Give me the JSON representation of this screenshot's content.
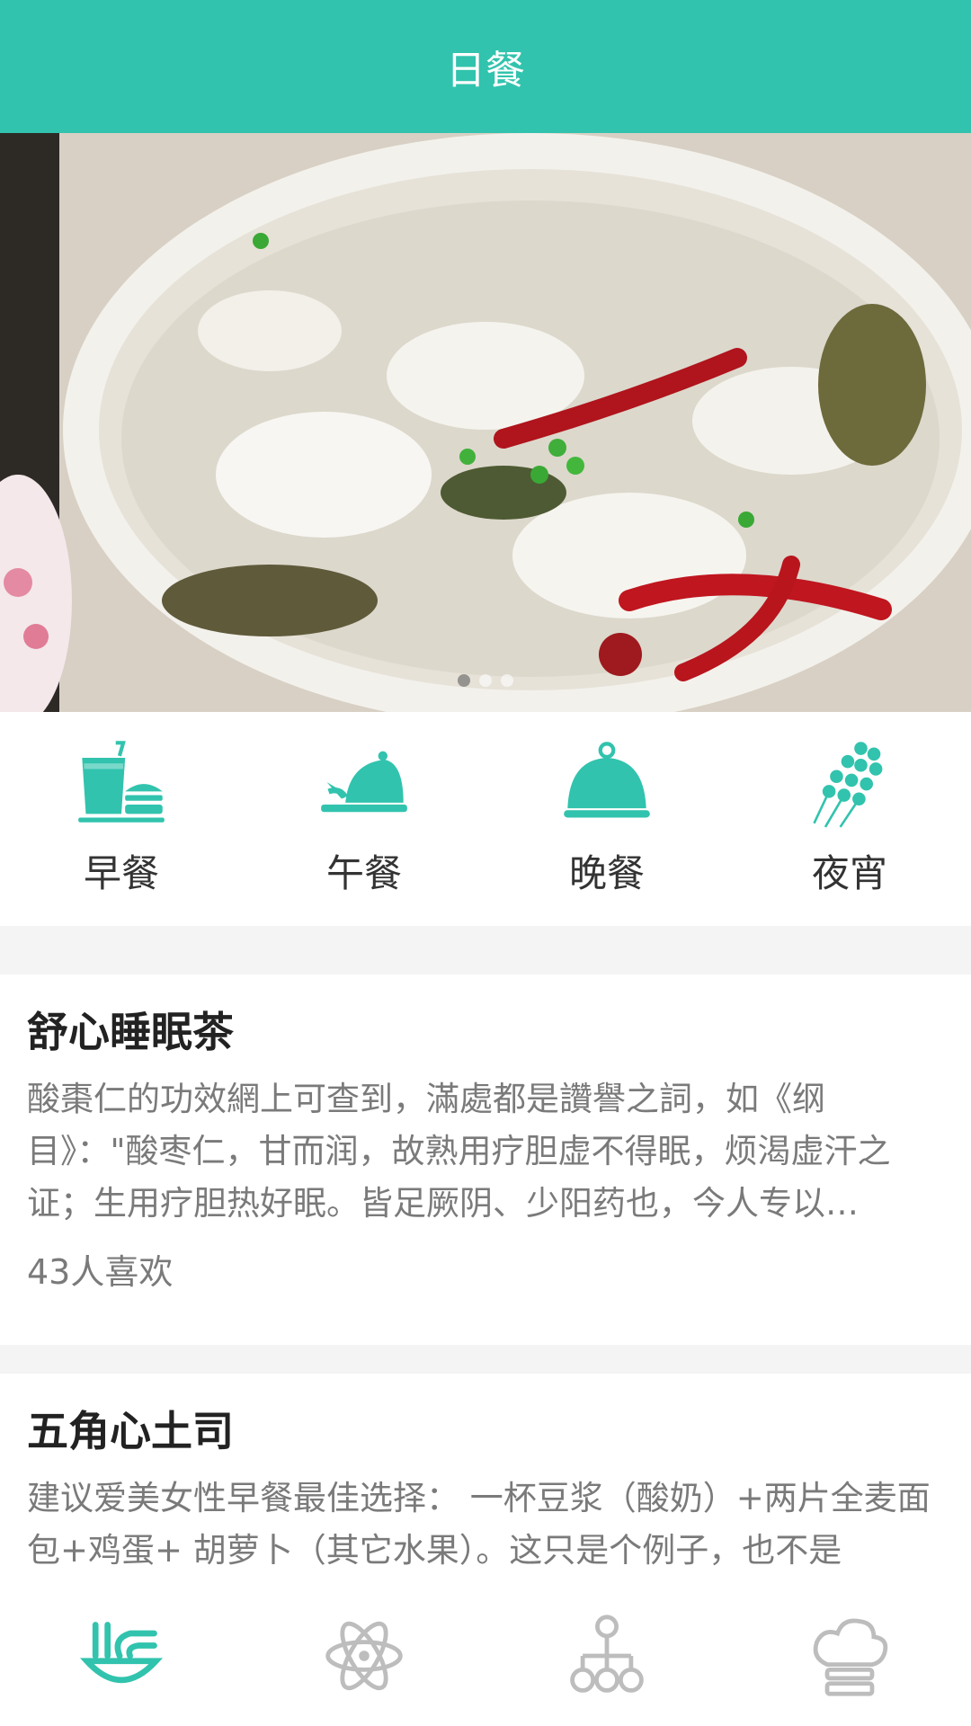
{
  "header": {
    "title": "日餐"
  },
  "banner": {
    "dots": 3,
    "active_dot": 0
  },
  "categories": [
    {
      "label": "早餐",
      "icon": "drink-burger-icon"
    },
    {
      "label": "午餐",
      "icon": "cloche-served-icon"
    },
    {
      "label": "晚餐",
      "icon": "cloche-icon"
    },
    {
      "label": "夜宵",
      "icon": "skewer-icon"
    }
  ],
  "cards": [
    {
      "title": "舒心睡眠茶",
      "desc": "酸棗仁的功效網上可查到，滿處都是讚譽之詞，如《纲目》：\"酸枣仁，甘而润，故熟用疗胆虚不得眠，烦渴虚汗之证；生用疗胆热好眠。皆足厥阴、少阳药也，今人专以…",
      "likes": "43人喜欢"
    },
    {
      "title": "五角心土司",
      "desc": "建议爱美女性早餐最佳选择： 一杯豆浆（酸奶）+两片全麦面包+鸡蛋+ 胡萝卜（其它水果）。这只是个例子，也不是"
    }
  ],
  "tabbar": [
    {
      "icon": "noodle-bowl-icon",
      "active": true
    },
    {
      "icon": "atom-icon",
      "active": false
    },
    {
      "icon": "org-chart-icon",
      "active": false
    },
    {
      "icon": "chef-hat-icon",
      "active": false
    }
  ],
  "colors": {
    "accent": "#31c3ad",
    "inactive": "#bdbdbd"
  }
}
